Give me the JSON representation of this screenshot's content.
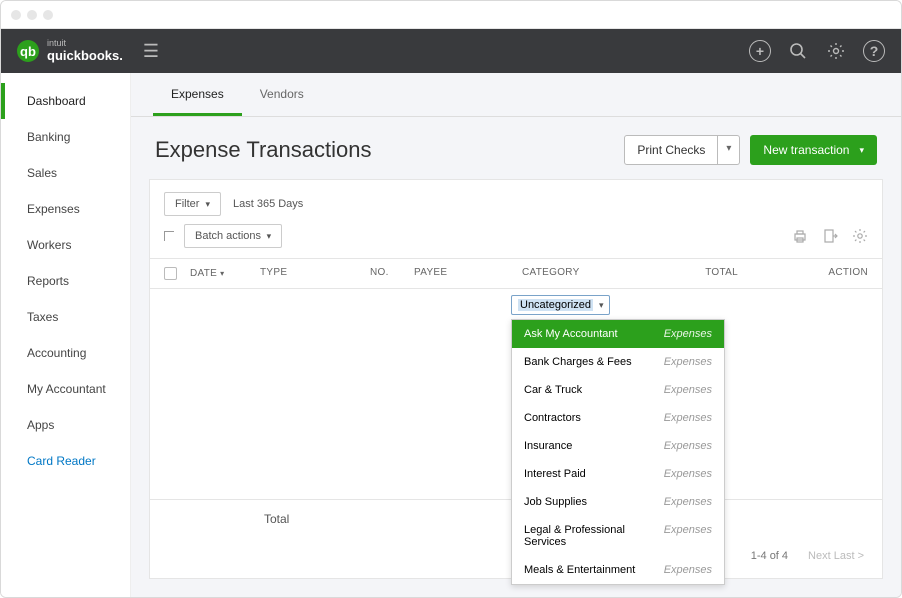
{
  "brand": {
    "intuit": "intuit",
    "name": "quickbooks."
  },
  "sidebar": {
    "items": [
      {
        "label": "Dashboard",
        "active": true
      },
      {
        "label": "Banking"
      },
      {
        "label": "Sales"
      },
      {
        "label": "Expenses"
      },
      {
        "label": "Workers"
      },
      {
        "label": "Reports"
      },
      {
        "label": "Taxes"
      },
      {
        "label": "Accounting"
      },
      {
        "label": "My Accountant"
      },
      {
        "label": "Apps"
      },
      {
        "label": "Card Reader",
        "link": true
      }
    ]
  },
  "tabs": [
    {
      "label": "Expenses",
      "active": true
    },
    {
      "label": "Vendors"
    }
  ],
  "page_title": "Expense Transactions",
  "header_buttons": {
    "print_checks": "Print Checks",
    "new_transaction": "New transaction"
  },
  "filter": {
    "button": "Filter",
    "range": "Last 365 Days",
    "batch": "Batch actions"
  },
  "columns": {
    "date": "DATE",
    "type": "TYPE",
    "no": "NO.",
    "payee": "PAYEE",
    "category": "CATEGORY",
    "total": "TOTAL",
    "action": "ACTION"
  },
  "category_select": {
    "value": "Uncategorized"
  },
  "category_options": [
    {
      "name": "Ask My Accountant",
      "type": "Expenses",
      "highlight": true
    },
    {
      "name": "Bank Charges & Fees",
      "type": "Expenses"
    },
    {
      "name": "Car & Truck",
      "type": "Expenses"
    },
    {
      "name": "Contractors",
      "type": "Expenses"
    },
    {
      "name": "Insurance",
      "type": "Expenses"
    },
    {
      "name": "Interest Paid",
      "type": "Expenses"
    },
    {
      "name": "Job Supplies",
      "type": "Expenses"
    },
    {
      "name": "Legal & Professional Services",
      "type": "Expenses"
    },
    {
      "name": "Meals & Entertainment",
      "type": "Expenses"
    }
  ],
  "total_label": "Total",
  "pager": {
    "range": "1-4 of 4",
    "next": "Next Last >"
  }
}
